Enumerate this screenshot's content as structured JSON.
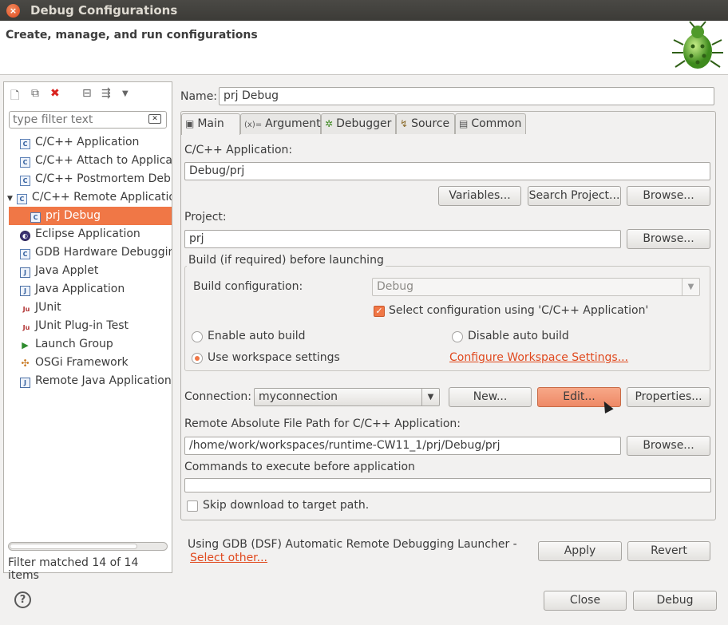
{
  "window": {
    "title": "Debug Configurations",
    "close_glyph": "×"
  },
  "header": {
    "heading": "Create, manage, and run configurations"
  },
  "left_panel": {
    "filter_placeholder": "type filter text",
    "tree": [
      {
        "label": "C/C++ Application",
        "icon": "c-config-icon",
        "glyph": "C"
      },
      {
        "label": "C/C++ Attach to Application",
        "icon": "c-config-icon",
        "glyph": "C"
      },
      {
        "label": "C/C++ Postmortem Debugger",
        "icon": "c-config-icon",
        "glyph": "C"
      },
      {
        "label": "C/C++ Remote Application",
        "icon": "c-config-icon",
        "glyph": "C",
        "expanded": true
      },
      {
        "label": "prj Debug",
        "icon": "c-config-icon",
        "glyph": "C",
        "selected": true,
        "child": true
      },
      {
        "label": "Eclipse Application",
        "icon": "eclipse-icon",
        "glyph": "◐"
      },
      {
        "label": "GDB Hardware Debugging",
        "icon": "c-config-icon",
        "glyph": "C"
      },
      {
        "label": "Java Applet",
        "icon": "java-icon",
        "glyph": "J"
      },
      {
        "label": "Java Application",
        "icon": "java-icon",
        "glyph": "J"
      },
      {
        "label": "JUnit",
        "icon": "junit-icon",
        "glyph": "Ju"
      },
      {
        "label": "JUnit Plug-in Test",
        "icon": "junit-icon",
        "glyph": "Ju"
      },
      {
        "label": "Launch Group",
        "icon": "play-icon",
        "glyph": "▶"
      },
      {
        "label": "OSGi Framework",
        "icon": "osgi-icon",
        "glyph": "✣"
      },
      {
        "label": "Remote Java Application",
        "icon": "remote-java-icon",
        "glyph": "J"
      }
    ],
    "filter_status": "Filter matched 14 of 14 items"
  },
  "name_label": "Name:",
  "name_value": "prj Debug",
  "tabs": [
    {
      "label": "Main",
      "glyph": "▣"
    },
    {
      "label": "Arguments",
      "glyph": "(x)="
    },
    {
      "label": "Debugger",
      "glyph": "✲"
    },
    {
      "label": "Source",
      "glyph": "↯"
    },
    {
      "label": "Common",
      "glyph": "▤"
    }
  ],
  "main": {
    "app_label": "C/C++ Application:",
    "app_value": "Debug/prj",
    "variables_btn": "Variables...",
    "search_project_btn": "Search Project...",
    "browse_btn": "Browse...",
    "project_label": "Project:",
    "project_value": "prj",
    "build_group_title": "Build (if required) before launching",
    "build_config_label": "Build configuration:",
    "build_config_value": "Debug",
    "select_config_label": "Select configuration using 'C/C++ Application'",
    "enable_auto_build": "Enable auto build",
    "disable_auto_build": "Disable auto build",
    "use_workspace": "Use workspace settings",
    "configure_workspace_link": "Configure Workspace Settings...",
    "connection_label": "Connection:",
    "connection_value": "myconnection",
    "new_btn": "New...",
    "edit_btn": "Edit...",
    "properties_btn": "Properties...",
    "remote_path_label": "Remote Absolute File Path for C/C++ Application:",
    "remote_path_value": "/home/work/workspaces/runtime-CW11_1/prj/Debug/prj",
    "commands_label": "Commands to execute before application",
    "commands_value": "",
    "skip_download_label": "Skip download to target path."
  },
  "launcher": {
    "text": "Using GDB (DSF) Automatic Remote Debugging Launcher -",
    "select_other": "Select other..."
  },
  "apply_btn": "Apply",
  "revert_btn": "Revert",
  "close_btn": "Close",
  "debug_btn": "Debug",
  "help_glyph": "?"
}
